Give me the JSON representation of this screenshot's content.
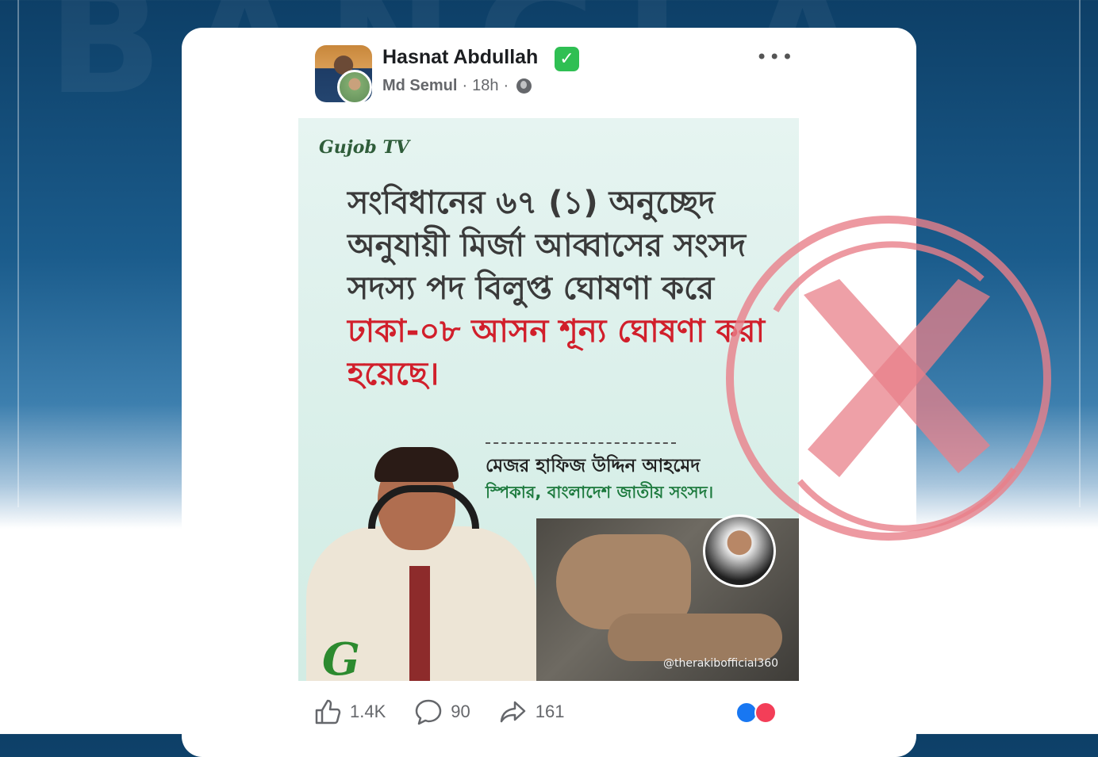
{
  "background": {
    "watermark_text": "BANGLA"
  },
  "post": {
    "author": "Hasnat Abdullah",
    "verified_mark": "✓",
    "shared_by": "Md Semul",
    "separator": "·",
    "time": "18h",
    "more_label": "•••",
    "image": {
      "channel_logo": "Gujob TV",
      "headline_part1": "সংবিধানের ৬৭ (১) অনুচ্ছেদ অনুযায়ী মির্জা আব্বাসের সংসদ সদস্য পদ বিলুপ্ত ঘোষণা করে",
      "headline_red": "ঢাকা-০৮ আসন শূন্য ঘোষণা করা হয়েছে।",
      "speaker_name": "মেজর হাফিজ উদ্দিন আহমেদ",
      "speaker_title": "স্পিকার, বাংলাদেশ জাতীয় সংসদ।",
      "g_logo": "G",
      "tiktok_handle": "@therakibofficial360"
    },
    "reactions": {
      "likes": "1.4K",
      "comments": "90",
      "shares": "161"
    }
  },
  "icons": [
    "avatar",
    "verified-badge-icon",
    "globe-icon",
    "more-icon",
    "like-icon",
    "comment-icon",
    "share-icon",
    "like-reaction-icon",
    "love-reaction-icon",
    "false-cross-stamp-icon"
  ],
  "colors": {
    "verified": "#2fbf53",
    "headline_red": "#d11f2b",
    "speaker_title_green": "#1d7a3e",
    "stamp": "#e8808a"
  }
}
